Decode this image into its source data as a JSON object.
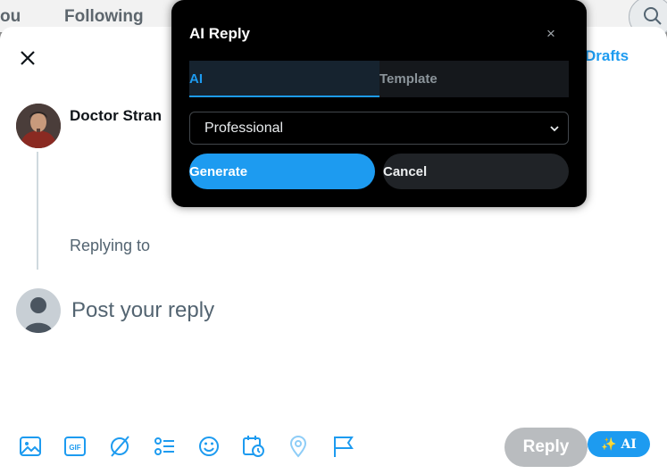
{
  "background_tabs": {
    "left_partial": "ou",
    "following": "Following"
  },
  "composer": {
    "drafts_label": "Drafts",
    "author_name": "Doctor Stran",
    "replying_to": "Replying to",
    "reply_placeholder": "Post your reply",
    "reply_button": "Reply",
    "ai_button": "✨ AI",
    "toolbar_icons": [
      "image-icon",
      "gif-icon",
      "grok-icon",
      "poll-icon",
      "emoji-icon",
      "schedule-icon",
      "location-icon",
      "flag-icon"
    ]
  },
  "modal": {
    "title": "AI Reply",
    "close_glyph": "×",
    "tabs": [
      {
        "label": "AI",
        "active": true
      },
      {
        "label": "Template",
        "active": false
      }
    ],
    "tone_selected": "Professional",
    "generate_label": "Generate",
    "cancel_label": "Cancel"
  },
  "colors": {
    "accent": "#1d9bf0",
    "modal_bg": "#000000",
    "reply_disabled": "#b9bcbf"
  }
}
